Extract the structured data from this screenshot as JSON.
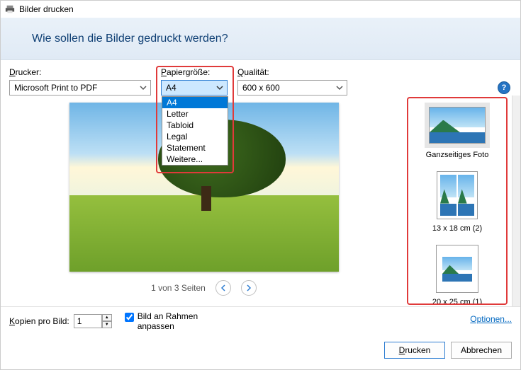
{
  "title": "Bilder drucken",
  "banner": "Wie sollen die Bilder gedruckt werden?",
  "labels": {
    "printer": "Drucker:",
    "paper": "Papiergröße:",
    "quality": "Qualität:",
    "copies": "Kopien pro Bild:",
    "fit": "Bild an Rahmen anpassen",
    "options": "Optionen..."
  },
  "printer_value": "Microsoft Print to PDF",
  "paper_value": "A4",
  "paper_options": [
    "A4",
    "Letter",
    "Tabloid",
    "Legal",
    "Statement",
    "Weitere..."
  ],
  "quality_value": "600 x 600",
  "copies_value": "1",
  "fit_checked": true,
  "pager": "1 von 3 Seiten",
  "layouts": [
    {
      "label": "Ganzseitiges Foto"
    },
    {
      "label": "13 x 18 cm (2)"
    },
    {
      "label": "20 x 25 cm (1)"
    }
  ],
  "buttons": {
    "print": "Drucken",
    "cancel": "Abbrechen"
  }
}
